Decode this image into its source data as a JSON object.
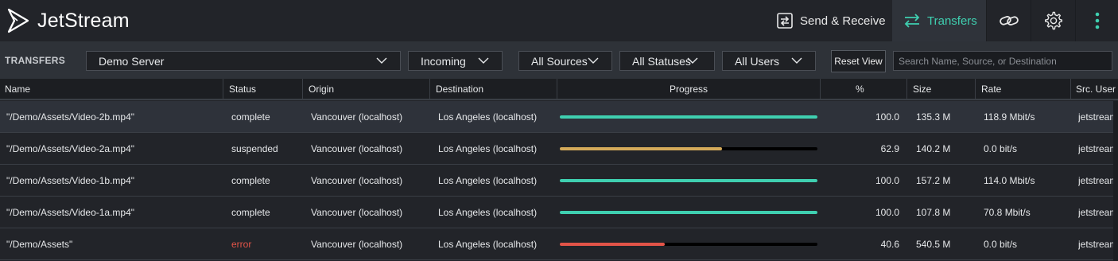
{
  "app": {
    "name": "JetStream",
    "colors": {
      "accent": "#3fcfb0",
      "complete": "#3fcfb0",
      "suspended": "#d4aa5a",
      "error": "#e25448"
    }
  },
  "nav": {
    "send_receive": {
      "label": "Send & Receive",
      "icon": "send-receive-icon"
    },
    "transfers": {
      "label": "Transfers",
      "icon": "transfer-arrows-icon",
      "active": true
    },
    "link_icon": "link-icon",
    "settings_icon": "gear-icon",
    "more_icon": "more-vertical-icon"
  },
  "filters": {
    "section_label": "TRANSFERS",
    "server": "Demo Server",
    "direction": "Incoming",
    "sources": "All Sources",
    "statuses": "All Statuses",
    "users": "All Users",
    "reset_label": "Reset View",
    "search_placeholder": "Search Name, Source, or Destination"
  },
  "table": {
    "columns": [
      "Name",
      "Status",
      "Origin",
      "Destination",
      "Progress",
      "%",
      "Size",
      "Rate",
      "Src. User"
    ],
    "rows": [
      {
        "name": "\"/Demo/Assets/Video-2b.mp4\"",
        "status": "complete",
        "origin": "Vancouver (localhost)",
        "destination": "Los Angeles (localhost)",
        "progress": 1.0,
        "percent": "100.0",
        "size": "135.3 M",
        "rate": "118.9 Mbit/s",
        "src_user": "jetstream",
        "selected": true
      },
      {
        "name": "\"/Demo/Assets/Video-2a.mp4\"",
        "status": "suspended",
        "origin": "Vancouver (localhost)",
        "destination": "Los Angeles (localhost)",
        "progress": 0.629,
        "percent": "62.9",
        "size": "140.2 M",
        "rate": "0.0 bit/s",
        "src_user": "jetstream",
        "selected": false
      },
      {
        "name": "\"/Demo/Assets/Video-1b.mp4\"",
        "status": "complete",
        "origin": "Vancouver (localhost)",
        "destination": "Los Angeles (localhost)",
        "progress": 1.0,
        "percent": "100.0",
        "size": "157.2 M",
        "rate": "114.0 Mbit/s",
        "src_user": "jetstream",
        "selected": false
      },
      {
        "name": "\"/Demo/Assets/Video-1a.mp4\"",
        "status": "complete",
        "origin": "Vancouver (localhost)",
        "destination": "Los Angeles (localhost)",
        "progress": 1.0,
        "percent": "100.0",
        "size": "107.8 M",
        "rate": "70.8 Mbit/s",
        "src_user": "jetstream",
        "selected": false
      },
      {
        "name": "\"/Demo/Assets\"",
        "status": "error",
        "origin": "Vancouver (localhost)",
        "destination": "Los Angeles (localhost)",
        "progress": 0.406,
        "percent": "40.6",
        "size": "540.5 M",
        "rate": "0.0 bit/s",
        "src_user": "jetstream",
        "selected": false
      }
    ]
  }
}
